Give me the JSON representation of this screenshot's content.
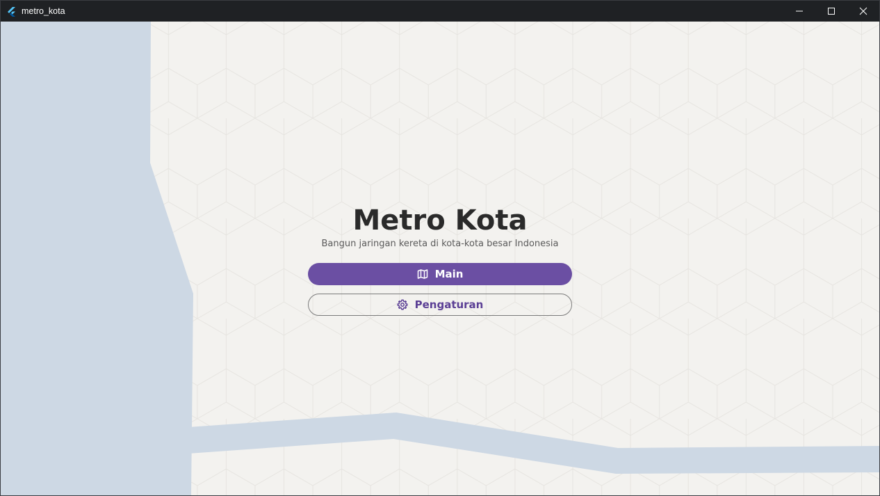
{
  "window": {
    "title": "metro_kota",
    "controls": [
      "minimize-icon",
      "maximize-icon",
      "close-icon"
    ]
  },
  "menu": {
    "title": "Metro Kota",
    "subtitle": "Bangun jaringan kereta di kota-kota besar Indonesia",
    "play_button": {
      "label": "Main",
      "icon": "map-icon"
    },
    "settings_button": {
      "label": "Pengaturan",
      "icon": "gear-icon"
    }
  },
  "colors": {
    "background": "#f3f2ef",
    "water": "#cdd8e4",
    "hex_grid": "#e6e4e0",
    "primary": "#6b4fa3",
    "title_text": "#2a2a2a",
    "titlebar": "#1f2124"
  }
}
